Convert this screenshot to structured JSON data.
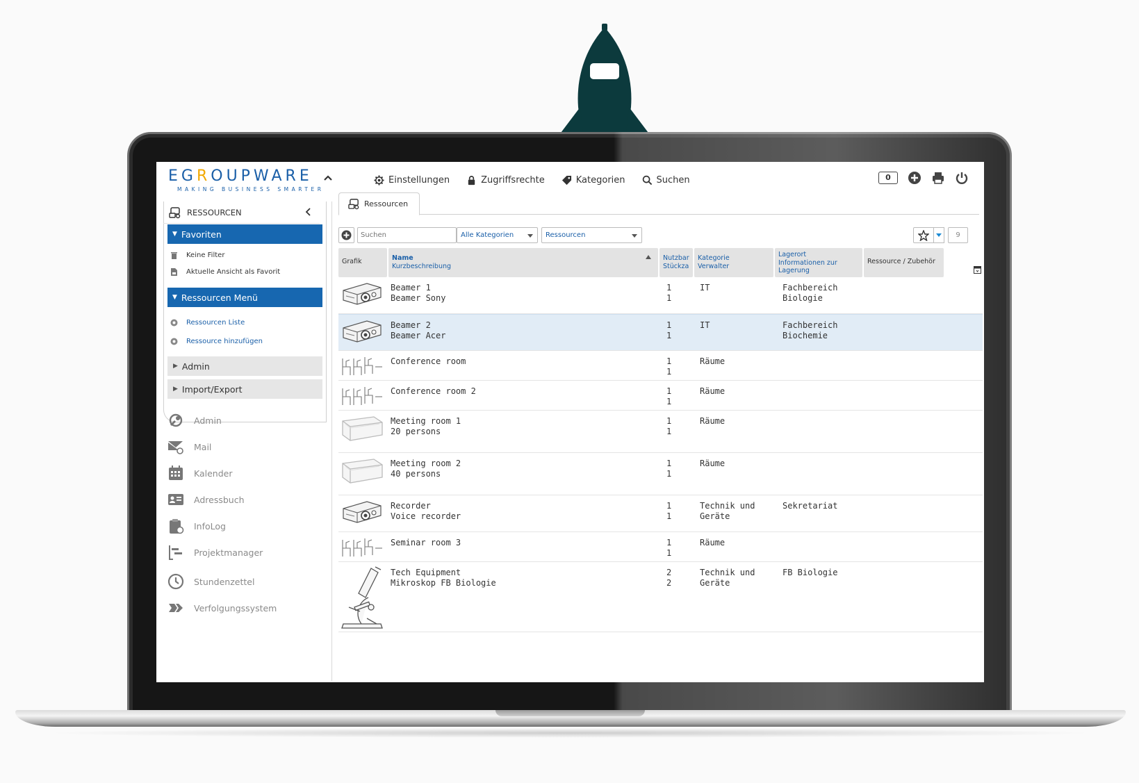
{
  "app": {
    "logo_text_1": "EG",
    "logo_text_y": "R",
    "logo_text_2": "OUPWARE",
    "logo_tagline": "MAKING BUSINESS SMARTER"
  },
  "topnav": [
    {
      "label": "Einstellungen",
      "icon": "gear-icon"
    },
    {
      "label": "Zugriffsrechte",
      "icon": "lock-icon"
    },
    {
      "label": "Kategorien",
      "icon": "tag-icon"
    },
    {
      "label": "Suchen",
      "icon": "search-icon"
    }
  ],
  "header_right": {
    "notification_count": "0"
  },
  "sidebar": {
    "title": "RESSOURCEN",
    "favorites_header": "Favoriten",
    "favorites": [
      "Keine Filter",
      "Aktuelle Ansicht als Favorit"
    ],
    "menu_header": "Ressourcen Menü",
    "menu": [
      "Ressourcen Liste",
      "Ressource hinzufügen"
    ],
    "collapsed": [
      "Admin",
      "Import/Export"
    ],
    "apps": [
      "Admin",
      "Mail",
      "Kalender",
      "Adressbuch",
      "InfoLog",
      "Projektmanager",
      "Stundenzettel",
      "Verfolgungssystem"
    ]
  },
  "tab": {
    "label": "Ressourcen"
  },
  "toolbar": {
    "search_placeholder": "Suchen",
    "category_select": "Alle Kategorien",
    "type_select": "Ressourcen",
    "row_count": "9"
  },
  "columns": {
    "grafik": "Grafik",
    "name": "Name",
    "kurzbeschreibung": "Kurzbeschreibung",
    "nutzbar": "Nutzbar",
    "stueckzahl": "Stückzah",
    "kategorie": "Kategorie",
    "verwalter": "Verwalter",
    "lagerort": "Lagerort",
    "lager_info_1": "Informationen zur",
    "lager_info_2": "Lagerung",
    "ressource_zubehoer": "Ressource / Zubehör"
  },
  "rows": [
    {
      "name": "Beamer 1",
      "desc": "Beamer Sony",
      "usable": "1",
      "count": "1",
      "cat1": "IT",
      "cat2": "",
      "loc1": "Fachbereich",
      "loc2": "Biologie",
      "thumb": "projector"
    },
    {
      "name": "Beamer 2",
      "desc": "Beamer Acer",
      "usable": "1",
      "count": "1",
      "cat1": "IT",
      "cat2": "",
      "loc1": "Fachbereich",
      "loc2": "Biochemie",
      "thumb": "projector"
    },
    {
      "name": "Conference room",
      "desc": "",
      "usable": "1",
      "count": "1",
      "cat1": "Räume",
      "cat2": "",
      "loc1": "",
      "loc2": "",
      "thumb": "chairs"
    },
    {
      "name": "Conference room 2",
      "desc": "",
      "usable": "1",
      "count": "1",
      "cat1": "Räume",
      "cat2": "",
      "loc1": "",
      "loc2": "",
      "thumb": "chairs"
    },
    {
      "name": "Meeting room 1",
      "desc": "20 persons",
      "usable": "1",
      "count": "1",
      "cat1": "Räume",
      "cat2": "",
      "loc1": "",
      "loc2": "",
      "thumb": "box"
    },
    {
      "name": "Meeting room 2",
      "desc": "40 persons",
      "usable": "1",
      "count": "1",
      "cat1": "Räume",
      "cat2": "",
      "loc1": "",
      "loc2": "",
      "thumb": "box"
    },
    {
      "name": "Recorder",
      "desc": "Voice recorder",
      "usable": "1",
      "count": "1",
      "cat1": "Technik und",
      "cat2": "Geräte",
      "loc1": "Sekretariat",
      "loc2": "",
      "thumb": "projector"
    },
    {
      "name": "Seminar room 3",
      "desc": "",
      "usable": "1",
      "count": "1",
      "cat1": "Räume",
      "cat2": "",
      "loc1": "",
      "loc2": "",
      "thumb": "chairs"
    },
    {
      "name": "Tech Equipment",
      "desc": "Mikroskop FB Biologie",
      "usable": "2",
      "count": "2",
      "cat1": "Technik und",
      "cat2": "Geräte",
      "loc1": "FB Biologie",
      "loc2": "",
      "thumb": "microscope"
    }
  ],
  "colors": {
    "accent": "#1767b0",
    "rocket": "#0c3a3d",
    "selected_row": "#e1ecf6"
  }
}
